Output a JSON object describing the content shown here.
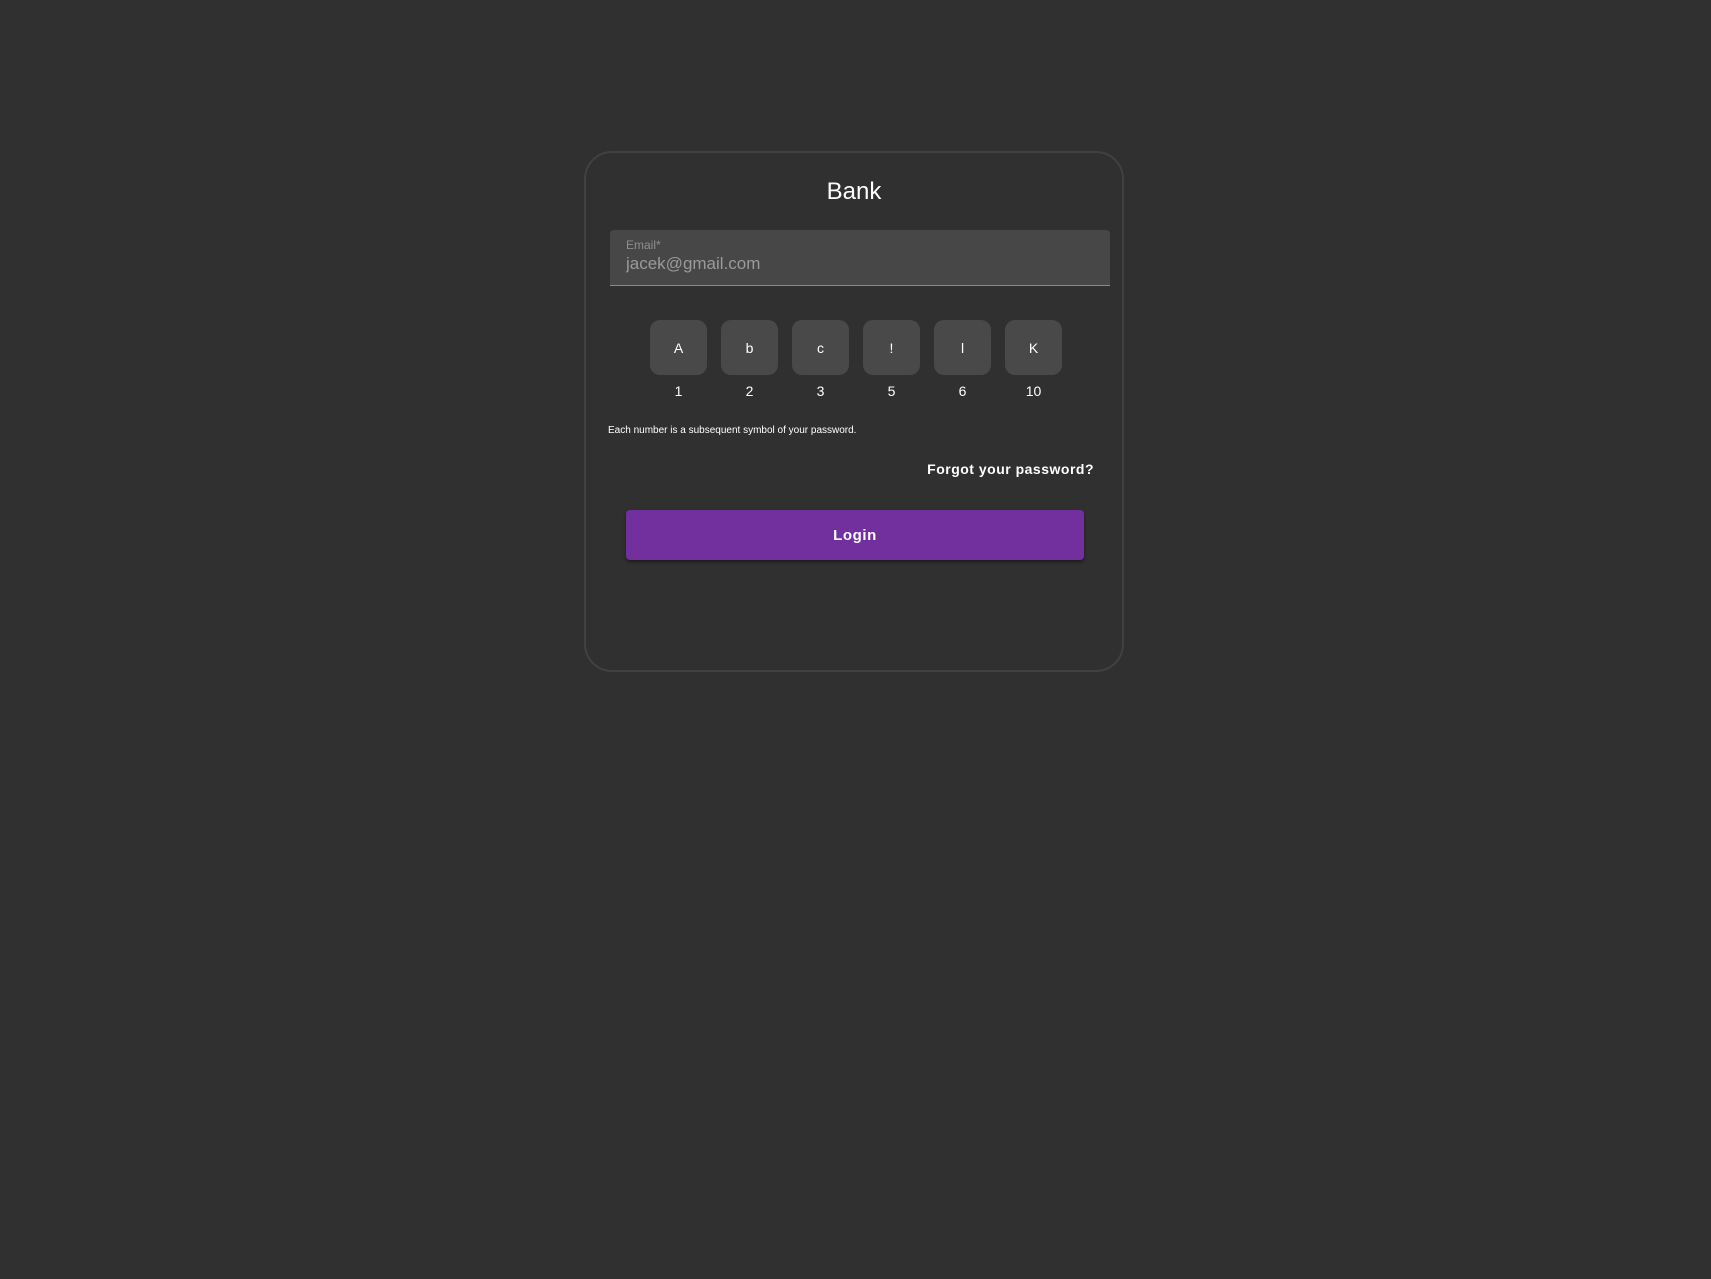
{
  "card": {
    "title": "Bank"
  },
  "email": {
    "label": "Email*",
    "value": "jacek@gmail.com"
  },
  "password_slots": [
    {
      "char": "A",
      "index": "1"
    },
    {
      "char": "b",
      "index": "2"
    },
    {
      "char": "c",
      "index": "3"
    },
    {
      "char": "!",
      "index": "5"
    },
    {
      "char": "l",
      "index": "6"
    },
    {
      "char": "K",
      "index": "10"
    }
  ],
  "hint": "Each number is a subsequent symbol of your password.",
  "forgot_label": "Forgot your password?",
  "login_label": "Login",
  "colors": {
    "background": "#303030",
    "accent": "#72309e"
  }
}
